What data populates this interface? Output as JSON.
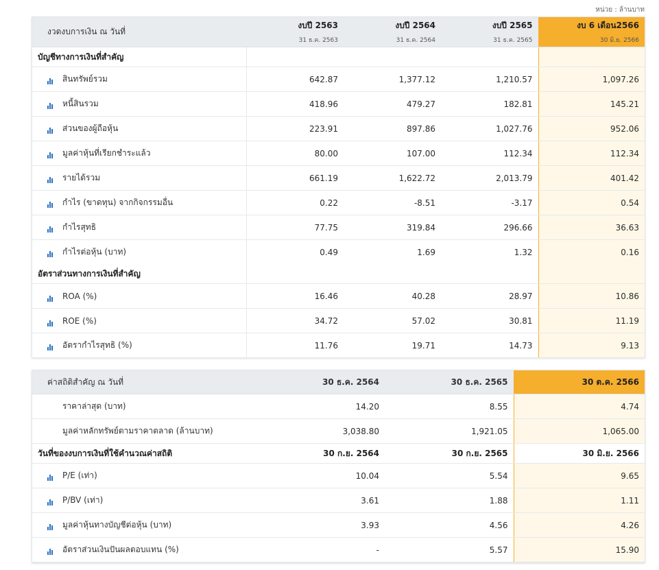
{
  "unit_note": "หน่วย : ล้านบาท",
  "table1": {
    "header_label": "งวดงบการเงิน ณ วันที่",
    "columns": [
      {
        "year": "งบปี 2563",
        "date": "31 ธ.ค. 2563"
      },
      {
        "year": "งบปี 2564",
        "date": "31 ธ.ค. 2564"
      },
      {
        "year": "งบปี 2565",
        "date": "31 ธ.ค. 2565"
      },
      {
        "year": "งบ 6 เดือน2566",
        "date": "30 มิ.ย. 2566"
      }
    ],
    "section1_title": "บัญชีทางการเงินที่สำคัญ",
    "section1_rows": [
      {
        "label": "สินทรัพย์รวม",
        "values": [
          "642.87",
          "1,377.12",
          "1,210.57",
          "1,097.26"
        ]
      },
      {
        "label": "หนี้สินรวม",
        "values": [
          "418.96",
          "479.27",
          "182.81",
          "145.21"
        ]
      },
      {
        "label": "ส่วนของผู้ถือหุ้น",
        "values": [
          "223.91",
          "897.86",
          "1,027.76",
          "952.06"
        ]
      },
      {
        "label": "มูลค่าหุ้นที่เรียกชำระแล้ว",
        "values": [
          "80.00",
          "107.00",
          "112.34",
          "112.34"
        ]
      },
      {
        "label": "รายได้รวม",
        "values": [
          "661.19",
          "1,622.72",
          "2,013.79",
          "401.42"
        ]
      },
      {
        "label": "กำไร (ขาดทุน) จากกิจกรรมอื่น",
        "values": [
          "0.22",
          "-8.51",
          "-3.17",
          "0.54"
        ]
      },
      {
        "label": "กำไรสุทธิ",
        "values": [
          "77.75",
          "319.84",
          "296.66",
          "36.63"
        ]
      },
      {
        "label": "กำไรต่อหุ้น (บาท)",
        "values": [
          "0.49",
          "1.69",
          "1.32",
          "0.16"
        ]
      }
    ],
    "section2_title": "อัตราส่วนทางการเงินที่สำคัญ",
    "section2_rows": [
      {
        "label": "ROA (%)",
        "values": [
          "16.46",
          "40.28",
          "28.97",
          "10.86"
        ]
      },
      {
        "label": "ROE (%)",
        "values": [
          "34.72",
          "57.02",
          "30.81",
          "11.19"
        ]
      },
      {
        "label": "อัตรากำไรสุทธิ (%)",
        "values": [
          "11.76",
          "19.71",
          "14.73",
          "9.13"
        ]
      }
    ]
  },
  "table2": {
    "header_label": "ค่าสถิติสำคัญ ณ วันที่",
    "columns": [
      "30 ธ.ค. 2564",
      "30 ธ.ค. 2565",
      "30 ต.ค. 2566"
    ],
    "rows_top": [
      {
        "label": "ราคาล่าสุด (บาท)",
        "values": [
          "14.20",
          "8.55",
          "4.74"
        ]
      },
      {
        "label": "มูลค่าหลักทรัพย์ตามราคาตลาด (ล้านบาท)",
        "values": [
          "3,038.80",
          "1,921.05",
          "1,065.00"
        ]
      }
    ],
    "section_title": "วันที่ของงบการเงินที่ใช้คำนวณค่าสถิติ",
    "section_dates": [
      "30 ก.ย. 2564",
      "30 ก.ย. 2565",
      "30 มิ.ย. 2566"
    ],
    "rows_bottom": [
      {
        "label": "P/E (เท่า)",
        "values": [
          "10.04",
          "5.54",
          "9.65"
        ]
      },
      {
        "label": "P/BV (เท่า)",
        "values": [
          "3.61",
          "1.88",
          "1.11"
        ]
      },
      {
        "label": "มูลค่าหุ้นทางบัญชีต่อหุ้น (บาท)",
        "values": [
          "3.93",
          "4.56",
          "4.26"
        ]
      },
      {
        "label": "อัตราส่วนเงินปันผลตอบแทน (%)",
        "values": [
          "-",
          "5.57",
          "15.90"
        ]
      }
    ]
  },
  "colors": {
    "highlight": "#f6ae2d",
    "highlight_bg": "#fff8e8",
    "header_bg": "#e9ecef",
    "icon": "#2a6fbf"
  },
  "icons": {
    "row_icon": "bar-chart-icon"
  }
}
